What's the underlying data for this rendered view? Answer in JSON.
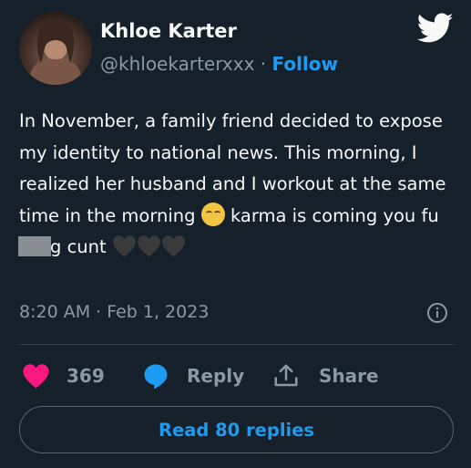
{
  "user": {
    "display_name": "Khloe Karter",
    "handle": "@khloekarterxxx",
    "separator": "·",
    "follow_label": "Follow"
  },
  "tweet": {
    "text_before_emoji": "In November, a family friend decided to expose my identity to national news. This morning, I realized her husband and I workout at the same time in the morning ",
    "text_after_emoji_start": " karma is coming you fu",
    "text_after_censor": "g cunt ",
    "timestamp": "8:20 AM · Feb 1, 2023"
  },
  "actions": {
    "like_count": "369",
    "reply_label": "Reply",
    "share_label": "Share"
  },
  "read_replies_label": "Read 80 replies",
  "colors": {
    "background": "#15202b",
    "accent": "#1d9bf0",
    "like_heart": "#f91880",
    "secondary_text": "#8b98a5"
  }
}
